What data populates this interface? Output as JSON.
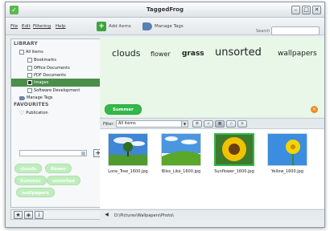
{
  "window": {
    "title": "TaggedFrog"
  },
  "menu": [
    "File",
    "Edit",
    "Filtering",
    "Help"
  ],
  "toolbar": {
    "add_items": "Add items",
    "manage_tags": "Manage Tags",
    "search_label": "Search for tags"
  },
  "sidebar": {
    "library_header": "LIBRARY",
    "items": [
      {
        "label": "All items"
      },
      {
        "label": "Bookmarks"
      },
      {
        "label": "Office Documents"
      },
      {
        "label": "PDF Documents"
      },
      {
        "label": "Images"
      },
      {
        "label": "Software Development"
      },
      {
        "label": "Manage Tags"
      }
    ],
    "favourites_header": "FAVOURITES",
    "favourites": [
      {
        "label": "Publication"
      }
    ],
    "tag_chips": [
      "clouds",
      "flower",
      "Summer",
      "unsorted",
      "wallpapers"
    ]
  },
  "tag_cloud": [
    {
      "word": "clouds"
    },
    {
      "word": "flower"
    },
    {
      "word": "grass"
    },
    {
      "word": "unsorted"
    },
    {
      "word": "wallpapers"
    }
  ],
  "active_filter_tag": "Summer",
  "filter": {
    "label": "Filter:",
    "value": "All items"
  },
  "items": [
    {
      "name": "Lone_Tree_1600.jpg"
    },
    {
      "name": "Bliss_Like_1600.jpg"
    },
    {
      "name": "Sunflower_1600.jpg"
    },
    {
      "name": "Yellow_1600.jpg"
    }
  ],
  "status": {
    "path": "D:\\Pictures\\Wallpapers\\Photo\\"
  },
  "colors": {
    "accent_green": "#33b84a",
    "cloud_bg": "#e8f7e8",
    "chip_green": "#bfeebe",
    "remove_orange": "#f08a24"
  }
}
